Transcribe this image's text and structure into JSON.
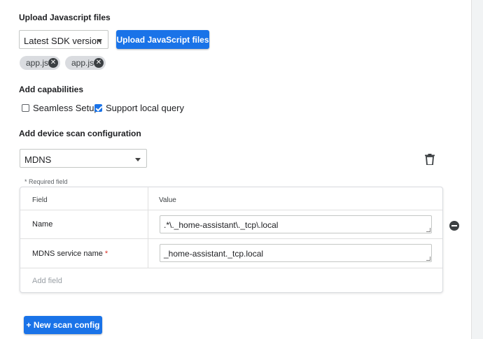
{
  "upload": {
    "title": "Upload Javascript files",
    "sdk_select_value": "Latest SDK version",
    "upload_button": "Upload JavaScript files",
    "files": [
      {
        "name": "app.js"
      },
      {
        "name": "app.js"
      }
    ]
  },
  "capabilities": {
    "title": "Add capabilities",
    "options": [
      {
        "label": "Seamless Setup",
        "checked": false
      },
      {
        "label": "Support local query",
        "checked": true
      }
    ]
  },
  "scan": {
    "title": "Add device scan configuration",
    "type_value": "MDNS",
    "required_note": "* Required field",
    "table": {
      "header_field": "Field",
      "header_value": "Value",
      "rows": [
        {
          "field": "Name",
          "required": false,
          "value": ".*\\._home-assistant\\._tcp\\.local"
        },
        {
          "field": "MDNS service name",
          "required": true,
          "value": "_home-assistant._tcp.local"
        }
      ],
      "add_field_placeholder": "Add field"
    },
    "new_config_button": "+ New scan config"
  },
  "colors": {
    "accent": "#1a73e8",
    "required": "#d93025"
  }
}
